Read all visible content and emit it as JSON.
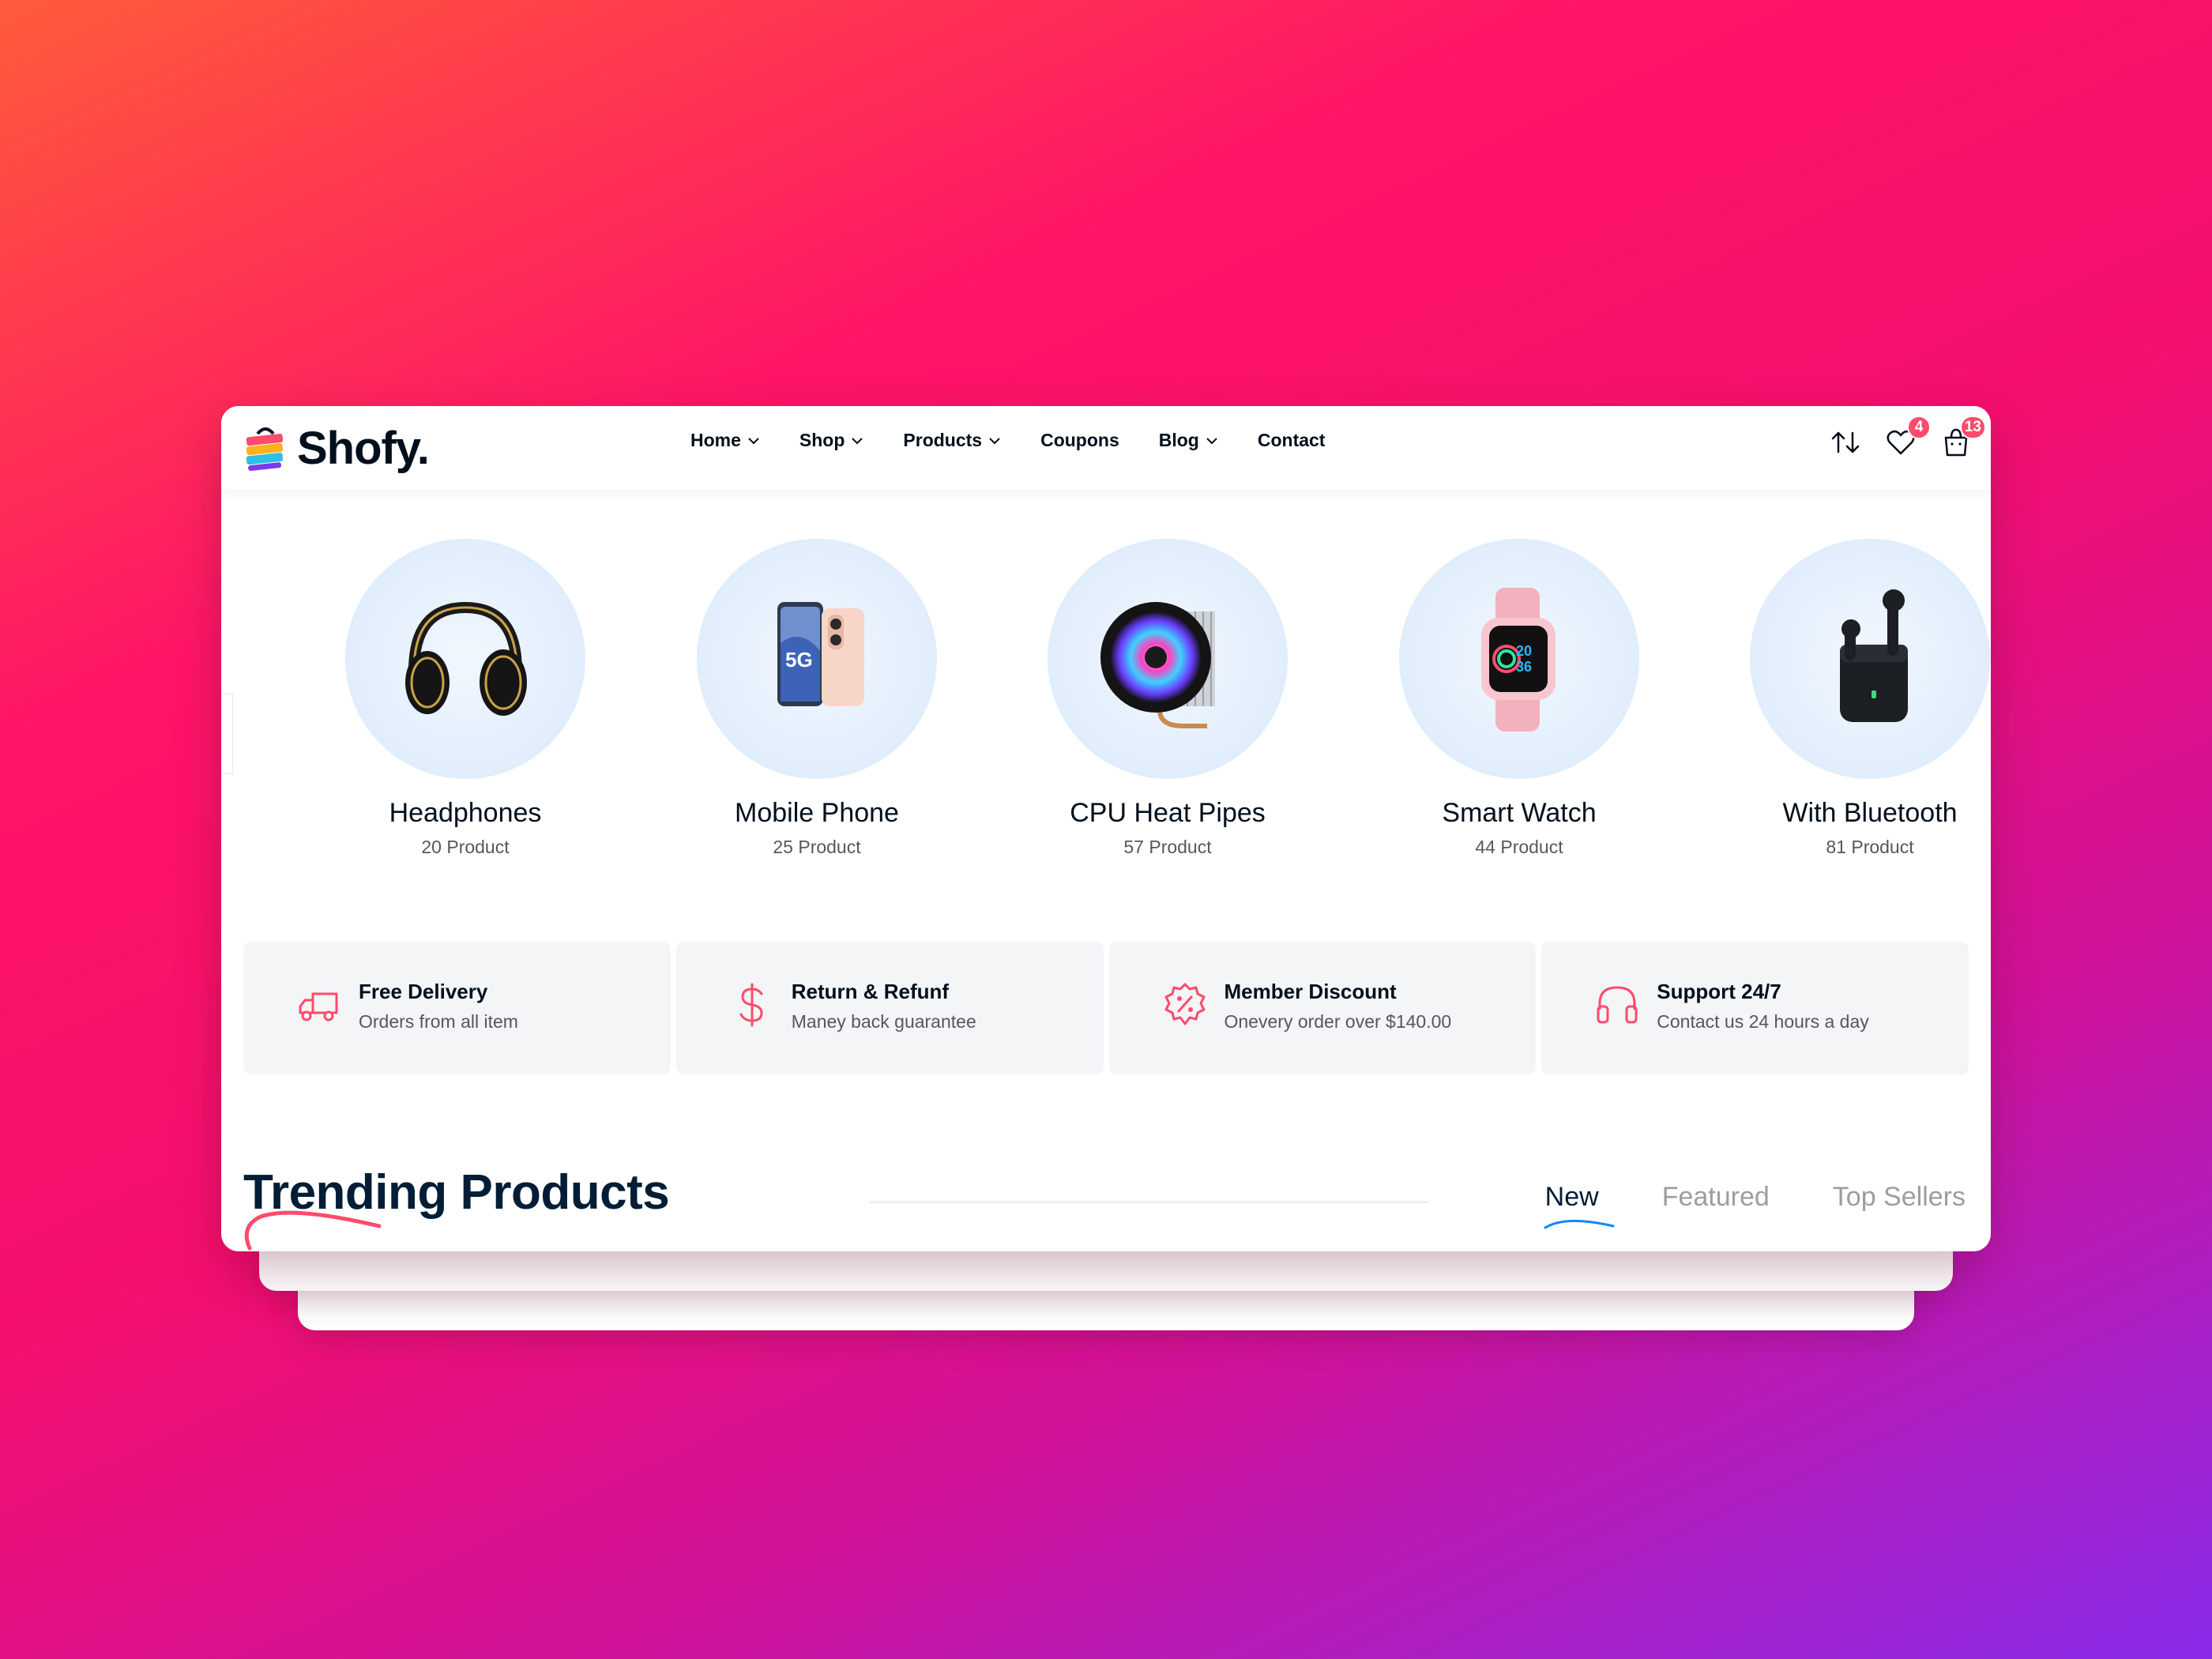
{
  "brand": {
    "name": "Shofy."
  },
  "nav": {
    "items": [
      {
        "label": "Home",
        "dropdown": true
      },
      {
        "label": "Shop",
        "dropdown": true
      },
      {
        "label": "Products",
        "dropdown": true
      },
      {
        "label": "Coupons",
        "dropdown": false
      },
      {
        "label": "Blog",
        "dropdown": true
      },
      {
        "label": "Contact",
        "dropdown": false
      }
    ]
  },
  "actions": {
    "compare_icon": "compare-icon",
    "wishlist_count": "4",
    "cart_count": "13"
  },
  "categories": [
    {
      "title": "Headphones",
      "count": "20 Product",
      "icon": "headphones"
    },
    {
      "title": "Mobile Phone",
      "count": "25 Product",
      "icon": "mobile-phone"
    },
    {
      "title": "CPU Heat Pipes",
      "count": "57 Product",
      "icon": "cpu-cooler"
    },
    {
      "title": "Smart Watch",
      "count": "44 Product",
      "icon": "smart-watch"
    },
    {
      "title": "With Bluetooth",
      "count": "81 Product",
      "icon": "earbuds"
    }
  ],
  "features": [
    {
      "title": "Free Delivery",
      "subtitle": "Orders from all item",
      "icon": "delivery-truck-icon"
    },
    {
      "title": "Return & Refunf",
      "subtitle": "Maney back guarantee",
      "icon": "dollar-icon"
    },
    {
      "title": "Member Discount",
      "subtitle": "Onevery order over $140.00",
      "icon": "discount-badge-icon"
    },
    {
      "title": "Support 24/7",
      "subtitle": "Contact us 24 hours a day",
      "icon": "headset-icon"
    }
  ],
  "trending": {
    "title": "Trending Products",
    "tabs": [
      "New",
      "Featured",
      "Top Sellers"
    ],
    "active_tab": "New"
  },
  "colors": {
    "accent": "#fd4b6b",
    "tab_underline": "#0989ff",
    "heading": "#010f1c"
  }
}
